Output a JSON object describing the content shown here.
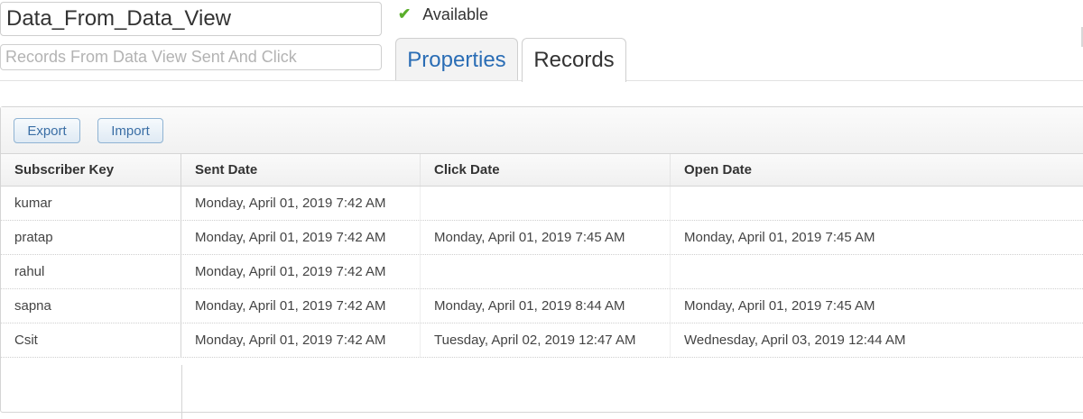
{
  "header": {
    "name_value": "Data_From_Data_View",
    "description_placeholder": "Records From Data View Sent And Click",
    "status": {
      "icon": "check-icon",
      "label": "Available",
      "color": "#5aae2b"
    }
  },
  "tabs": [
    {
      "label": "Properties",
      "active": false
    },
    {
      "label": "Records",
      "active": true
    }
  ],
  "toolbar": {
    "export_label": "Export",
    "import_label": "Import"
  },
  "table": {
    "columns": [
      "Subscriber Key",
      "Sent Date",
      "Click Date",
      "Open Date"
    ],
    "rows": [
      [
        "kumar",
        "Monday, April 01, 2019 7:42 AM",
        "",
        ""
      ],
      [
        "pratap",
        "Monday, April 01, 2019 7:42 AM",
        "Monday, April 01, 2019 7:45 AM",
        "Monday, April 01, 2019 7:45 AM"
      ],
      [
        "rahul",
        "Monday, April 01, 2019 7:42 AM",
        "",
        ""
      ],
      [
        "sapna",
        "Monday, April 01, 2019 7:42 AM",
        "Monday, April 01, 2019 8:44 AM",
        "Monday, April 01, 2019 7:45 AM"
      ],
      [
        "Csit",
        "Monday, April 01, 2019 7:42 AM",
        "Tuesday, April 02, 2019 12:47 AM",
        "Wednesday, April 03, 2019 12:44 AM"
      ]
    ]
  },
  "colors": {
    "link_blue": "#2a6db5",
    "button_text": "#3a6ea5",
    "border": "#d5d5d5"
  }
}
